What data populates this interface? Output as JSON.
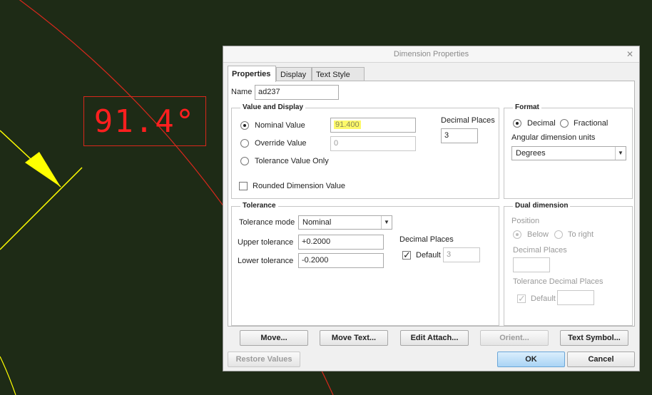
{
  "canvas": {
    "dimension_text": "91.4°",
    "colors": {
      "background": "#1e2b16",
      "arc": "#d8281c",
      "arrow": "#ffff00",
      "label": "#ff1f1f"
    }
  },
  "dialog": {
    "title": "Dimension Properties",
    "close_icon": "close-icon",
    "tabs": [
      {
        "label": "Properties",
        "active": true
      },
      {
        "label": "Display",
        "active": false
      },
      {
        "label": "Text Style",
        "active": false
      }
    ],
    "name_label": "Name",
    "name_value": "ad237",
    "value_display": {
      "title": "Value and Display",
      "nominal_label": "Nominal Value",
      "nominal_value": "91.400",
      "override_label": "Override Value",
      "override_value": "0",
      "tolerance_only_label": "Tolerance Value Only",
      "decimal_places_label": "Decimal Places",
      "decimal_places_value": "3",
      "rounded_label": "Rounded Dimension Value"
    },
    "format": {
      "title": "Format",
      "decimal_label": "Decimal",
      "fractional_label": "Fractional",
      "angular_units_label": "Angular dimension units",
      "angular_units_value": "Degrees"
    },
    "tolerance": {
      "title": "Tolerance",
      "mode_label": "Tolerance mode",
      "mode_value": "Nominal",
      "upper_label": "Upper tolerance",
      "upper_value": "+0.2000",
      "lower_label": "Lower tolerance",
      "lower_value": "-0.2000",
      "decimal_places_label": "Decimal Places",
      "default_label": "Default",
      "default_value": "3"
    },
    "dual": {
      "title": "Dual dimension",
      "position_label": "Position",
      "below_label": "Below",
      "to_right_label": "To right",
      "decimal_places_label": "Decimal Places",
      "tol_decimal_label": "Tolerance Decimal Places",
      "default_label": "Default"
    },
    "buttons": {
      "move": "Move...",
      "move_text": "Move Text...",
      "edit_attach": "Edit Attach...",
      "orient": "Orient...",
      "text_symbol": "Text Symbol...",
      "restore": "Restore Values",
      "ok": "OK",
      "cancel": "Cancel"
    }
  }
}
